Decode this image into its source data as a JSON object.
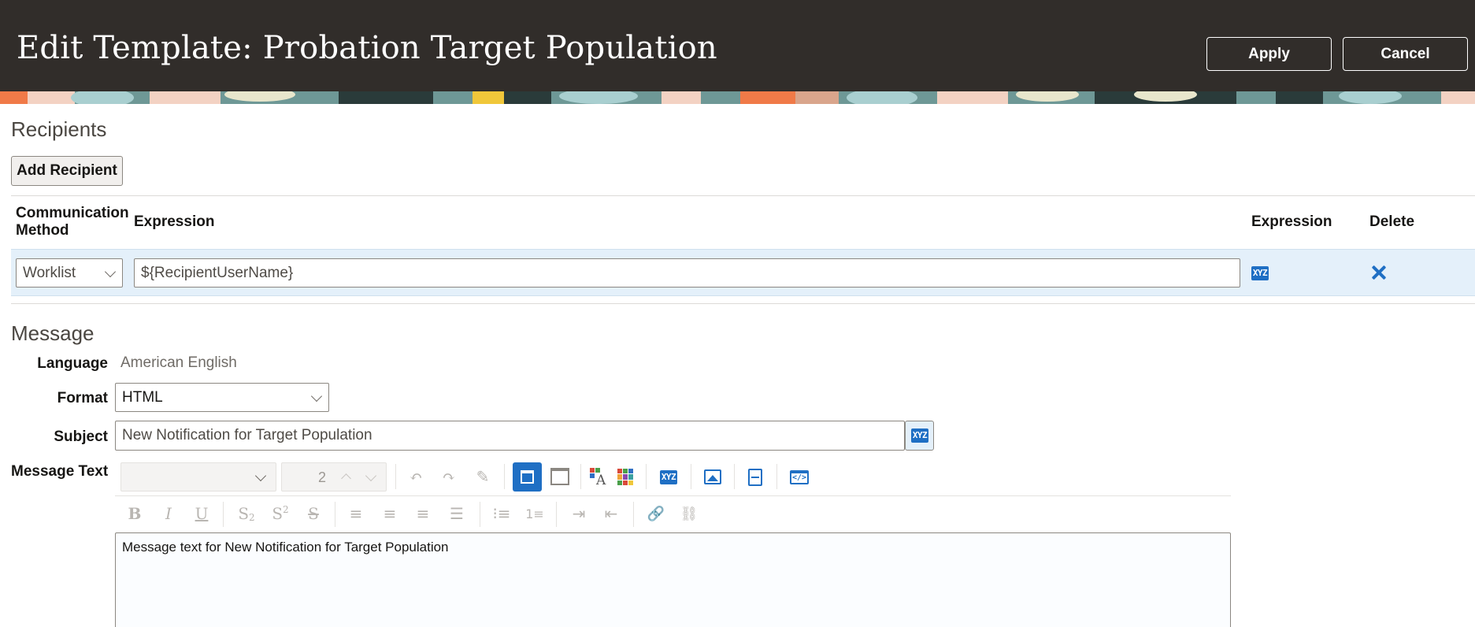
{
  "header": {
    "title": "Edit Template: Probation Target Population",
    "apply_label": "Apply",
    "cancel_label": "Cancel"
  },
  "recipients": {
    "section_title": "Recipients",
    "add_button_label": "Add Recipient",
    "columns": {
      "communication_method": "Communication Method",
      "expression": "Expression",
      "expression_builder": "Expression",
      "delete": "Delete"
    },
    "rows": [
      {
        "communication_method": "Worklist",
        "expression": "${RecipientUserName}"
      }
    ]
  },
  "message": {
    "section_title": "Message",
    "language_label": "Language",
    "language_value": "American English",
    "format_label": "Format",
    "format_value": "HTML",
    "subject_label": "Subject",
    "subject_value": "New Notification for Target Population",
    "message_text_label": "Message Text",
    "font_size_value": "2",
    "body_text": "Message text for New Notification for Target Population"
  },
  "icons": {
    "expression_builder": "xyz-icon",
    "delete": "close-icon",
    "colors": {
      "accent_blue": "#1f6fc4",
      "header_bg": "#312d2a"
    }
  }
}
